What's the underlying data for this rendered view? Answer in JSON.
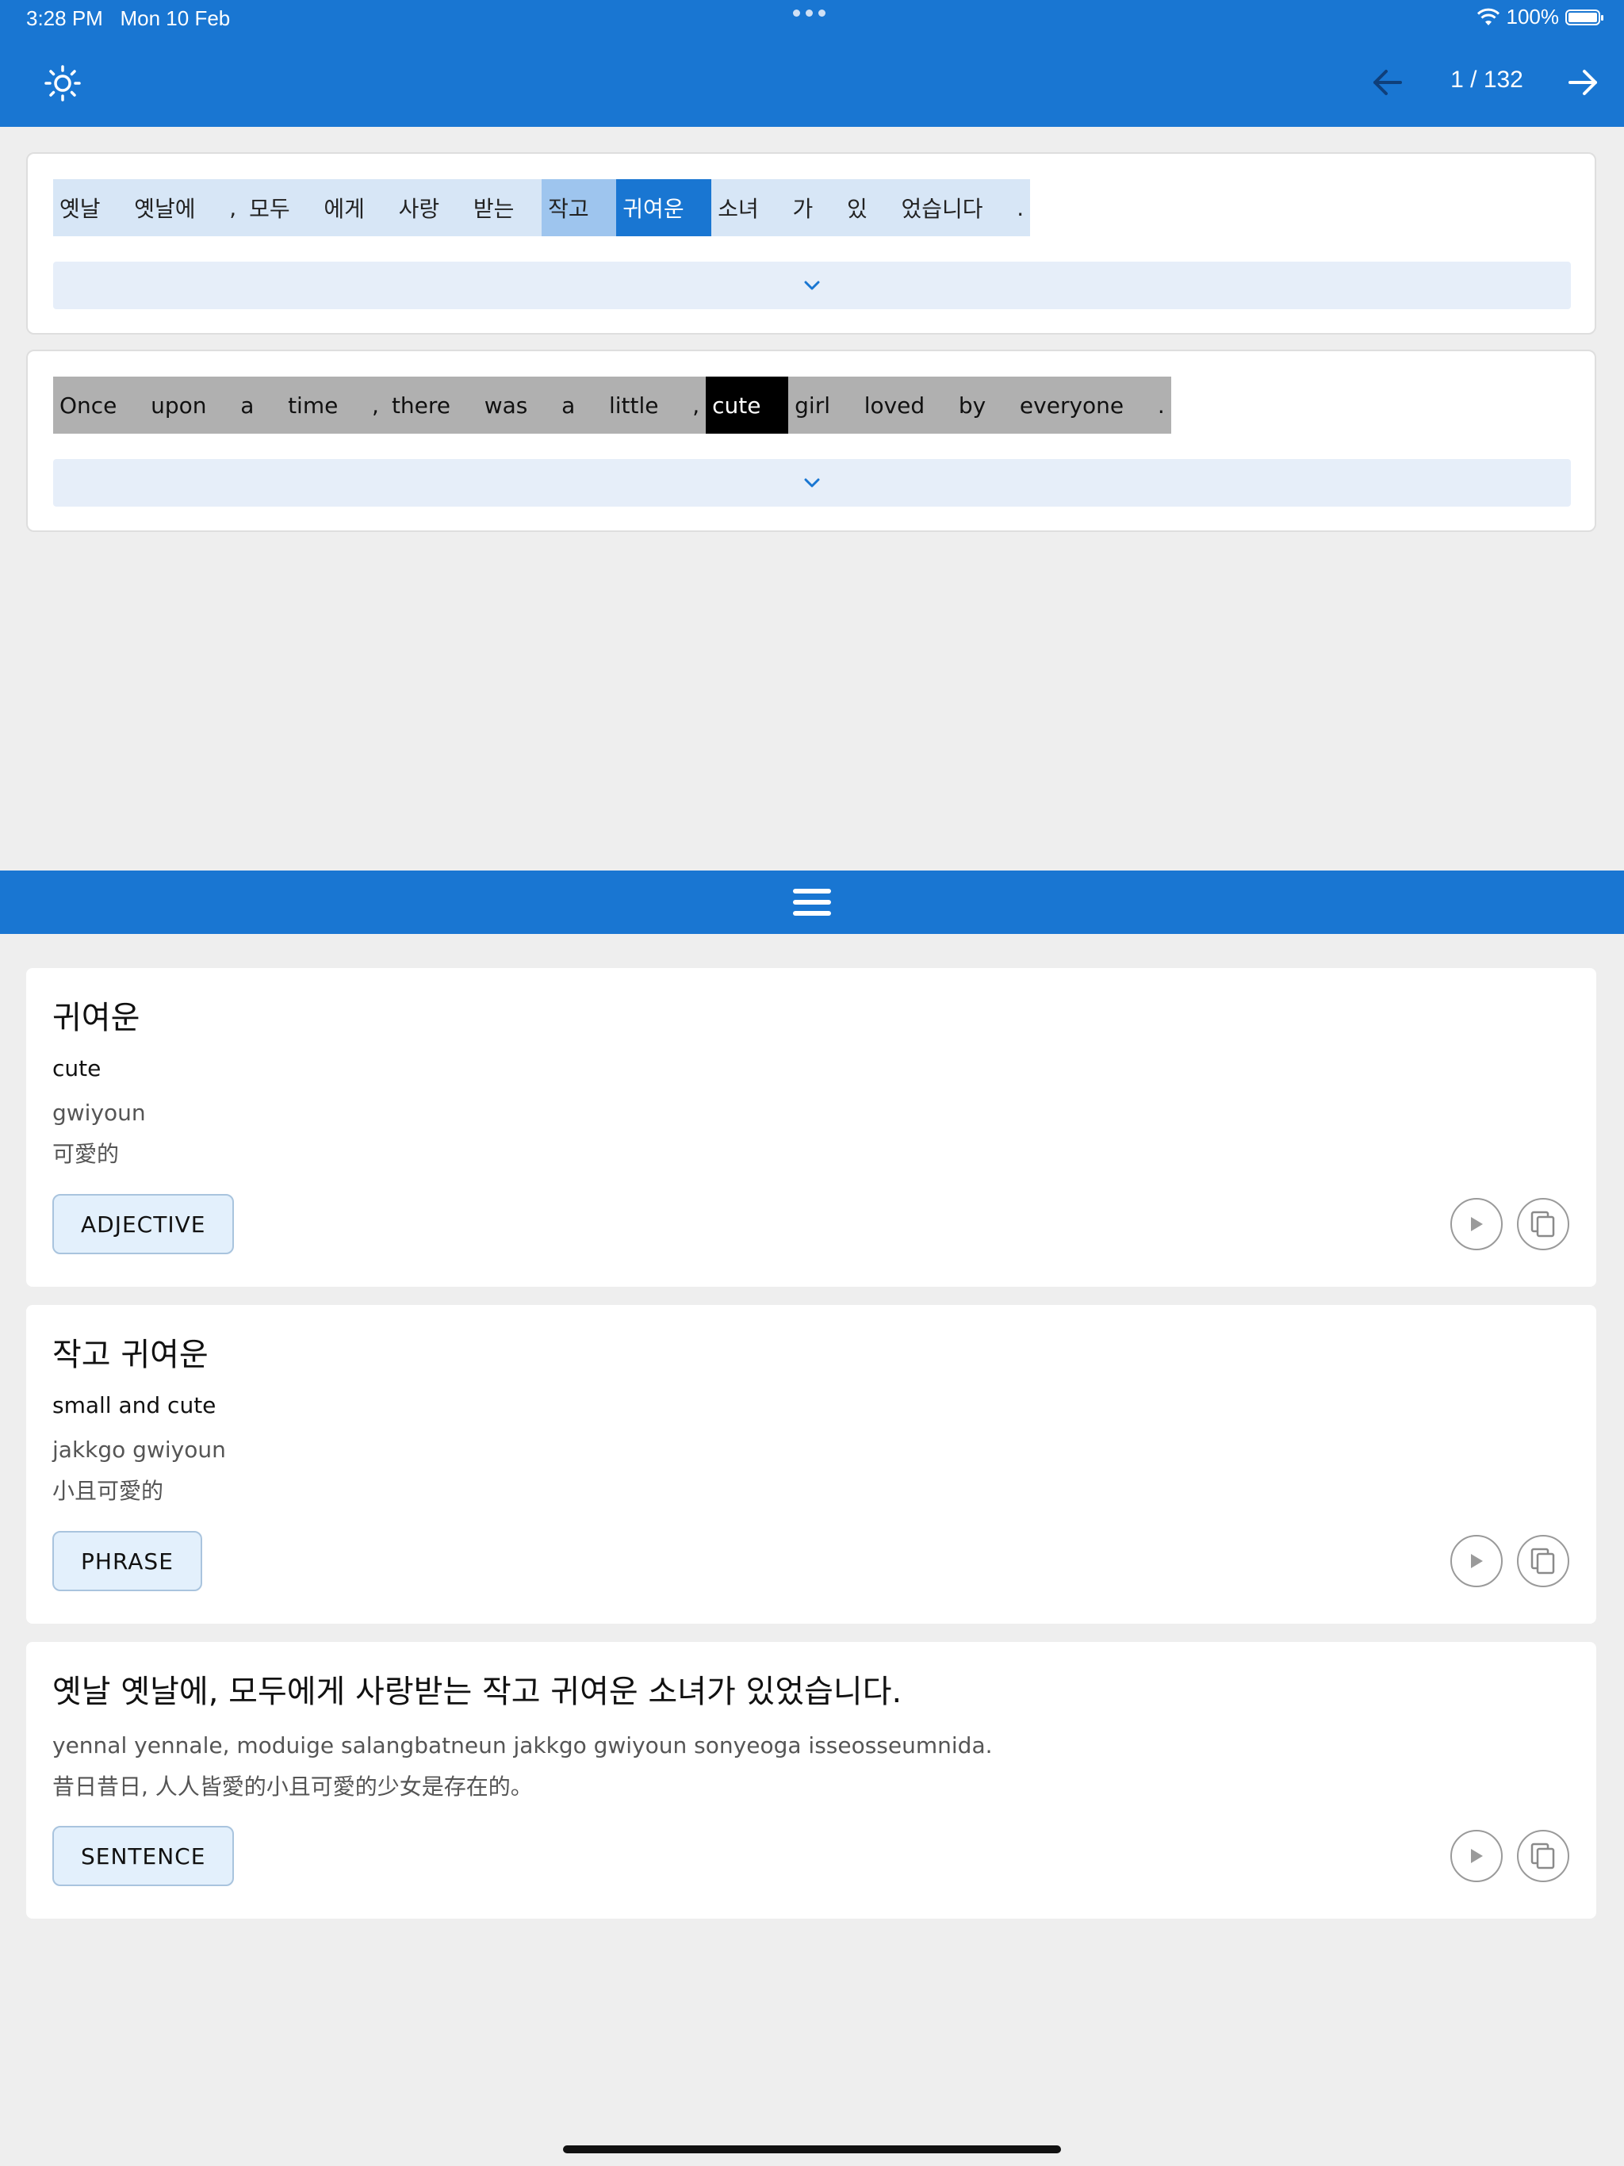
{
  "status_bar": {
    "time": "3:28 PM",
    "date": "Mon 10 Feb",
    "battery": "100%",
    "battery_level": 1.0
  },
  "app_bar": {
    "theme_icon": "sun-icon",
    "prev_icon": "arrow-left-icon",
    "next_icon": "arrow-right-icon",
    "page_indicator": "1 / 132"
  },
  "korean_sentence": {
    "tokens": [
      {
        "text": "옛날",
        "state": "normal"
      },
      {
        "text": "옛날에",
        "state": "normal"
      },
      {
        "text": ",",
        "state": "normal"
      },
      {
        "text": "모두",
        "state": "normal"
      },
      {
        "text": "에게",
        "state": "normal"
      },
      {
        "text": "사랑",
        "state": "normal"
      },
      {
        "text": "받는",
        "state": "normal"
      },
      {
        "text": "작고",
        "state": "selected-light"
      },
      {
        "text": "귀여운",
        "state": "selected-dark"
      },
      {
        "text": "소녀",
        "state": "normal"
      },
      {
        "text": "가",
        "state": "normal"
      },
      {
        "text": "있",
        "state": "normal"
      },
      {
        "text": "었습니다",
        "state": "normal"
      },
      {
        "text": ".",
        "state": "normal"
      }
    ],
    "expand_icon": "chevron-down-icon"
  },
  "english_sentence": {
    "tokens": [
      {
        "text": "Once",
        "state": "normal"
      },
      {
        "text": "upon",
        "state": "normal"
      },
      {
        "text": "a",
        "state": "normal"
      },
      {
        "text": "time",
        "state": "normal"
      },
      {
        "text": ",",
        "state": "normal"
      },
      {
        "text": "there",
        "state": "normal"
      },
      {
        "text": "was",
        "state": "normal"
      },
      {
        "text": "a",
        "state": "normal"
      },
      {
        "text": "little",
        "state": "normal"
      },
      {
        "text": ",",
        "state": "normal"
      },
      {
        "text": "cute",
        "state": "selected"
      },
      {
        "text": "girl",
        "state": "normal"
      },
      {
        "text": "loved",
        "state": "normal"
      },
      {
        "text": "by",
        "state": "normal"
      },
      {
        "text": "everyone",
        "state": "normal"
      },
      {
        "text": ".",
        "state": "normal"
      }
    ],
    "expand_icon": "chevron-down-icon"
  },
  "splitter": {
    "icon": "menu-icon"
  },
  "details": [
    {
      "headword": "귀여운",
      "translation": "cute",
      "romanization": "gwiyoun",
      "chinese": "可愛的",
      "tag": "ADJECTIVE"
    },
    {
      "headword": "작고 귀여운",
      "translation": "small and cute",
      "romanization": "jakkgo gwiyoun",
      "chinese": "小且可愛的",
      "tag": "PHRASE"
    },
    {
      "headword": "옛날 옛날에, 모두에게 사랑받는 작고 귀여운 소녀가 있었습니다.",
      "romanization": "yennal yennale, moduige salangbatneun jakkgo gwiyoun sonyeoga isseosseumnida.",
      "chinese": "昔日昔日, 人人皆愛的小且可愛的少女是存在的。",
      "tag": "SENTENCE"
    }
  ],
  "colors": {
    "primary": "#1976d2",
    "token_ko_bg": "#d7e6f6",
    "token_ko_selected_light": "#9ec5ee",
    "token_en_bg": "#b0b0b0",
    "token_en_selected": "#000000",
    "tag_bg": "#e3f0fc"
  }
}
